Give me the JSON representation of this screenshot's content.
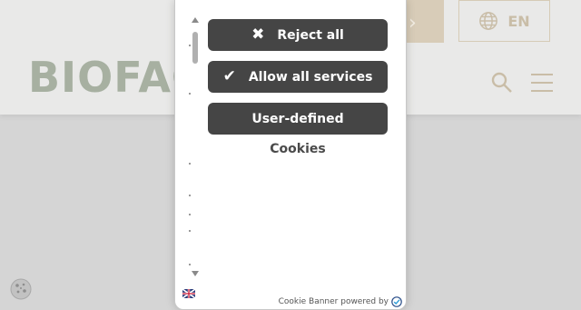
{
  "site": {
    "logo": "BIOFAC",
    "cta_chevron": "›",
    "language": "EN",
    "icons": [
      "globe-icon",
      "search-icon",
      "menu-icon",
      "cookie-icon"
    ]
  },
  "consent": {
    "reject_all": "Reject all",
    "allow_all": "Allow all services",
    "user_defined": "User-defined",
    "cookies": "Cookies",
    "powered_by": "Cookie Banner powered by",
    "reject_icon": "✖",
    "allow_icon": "✔"
  },
  "colors": {
    "button_bg": "#454545",
    "button_text": "#ffffff",
    "logo": "#a7b0a1",
    "accent_beige": "#d8ccb8"
  }
}
